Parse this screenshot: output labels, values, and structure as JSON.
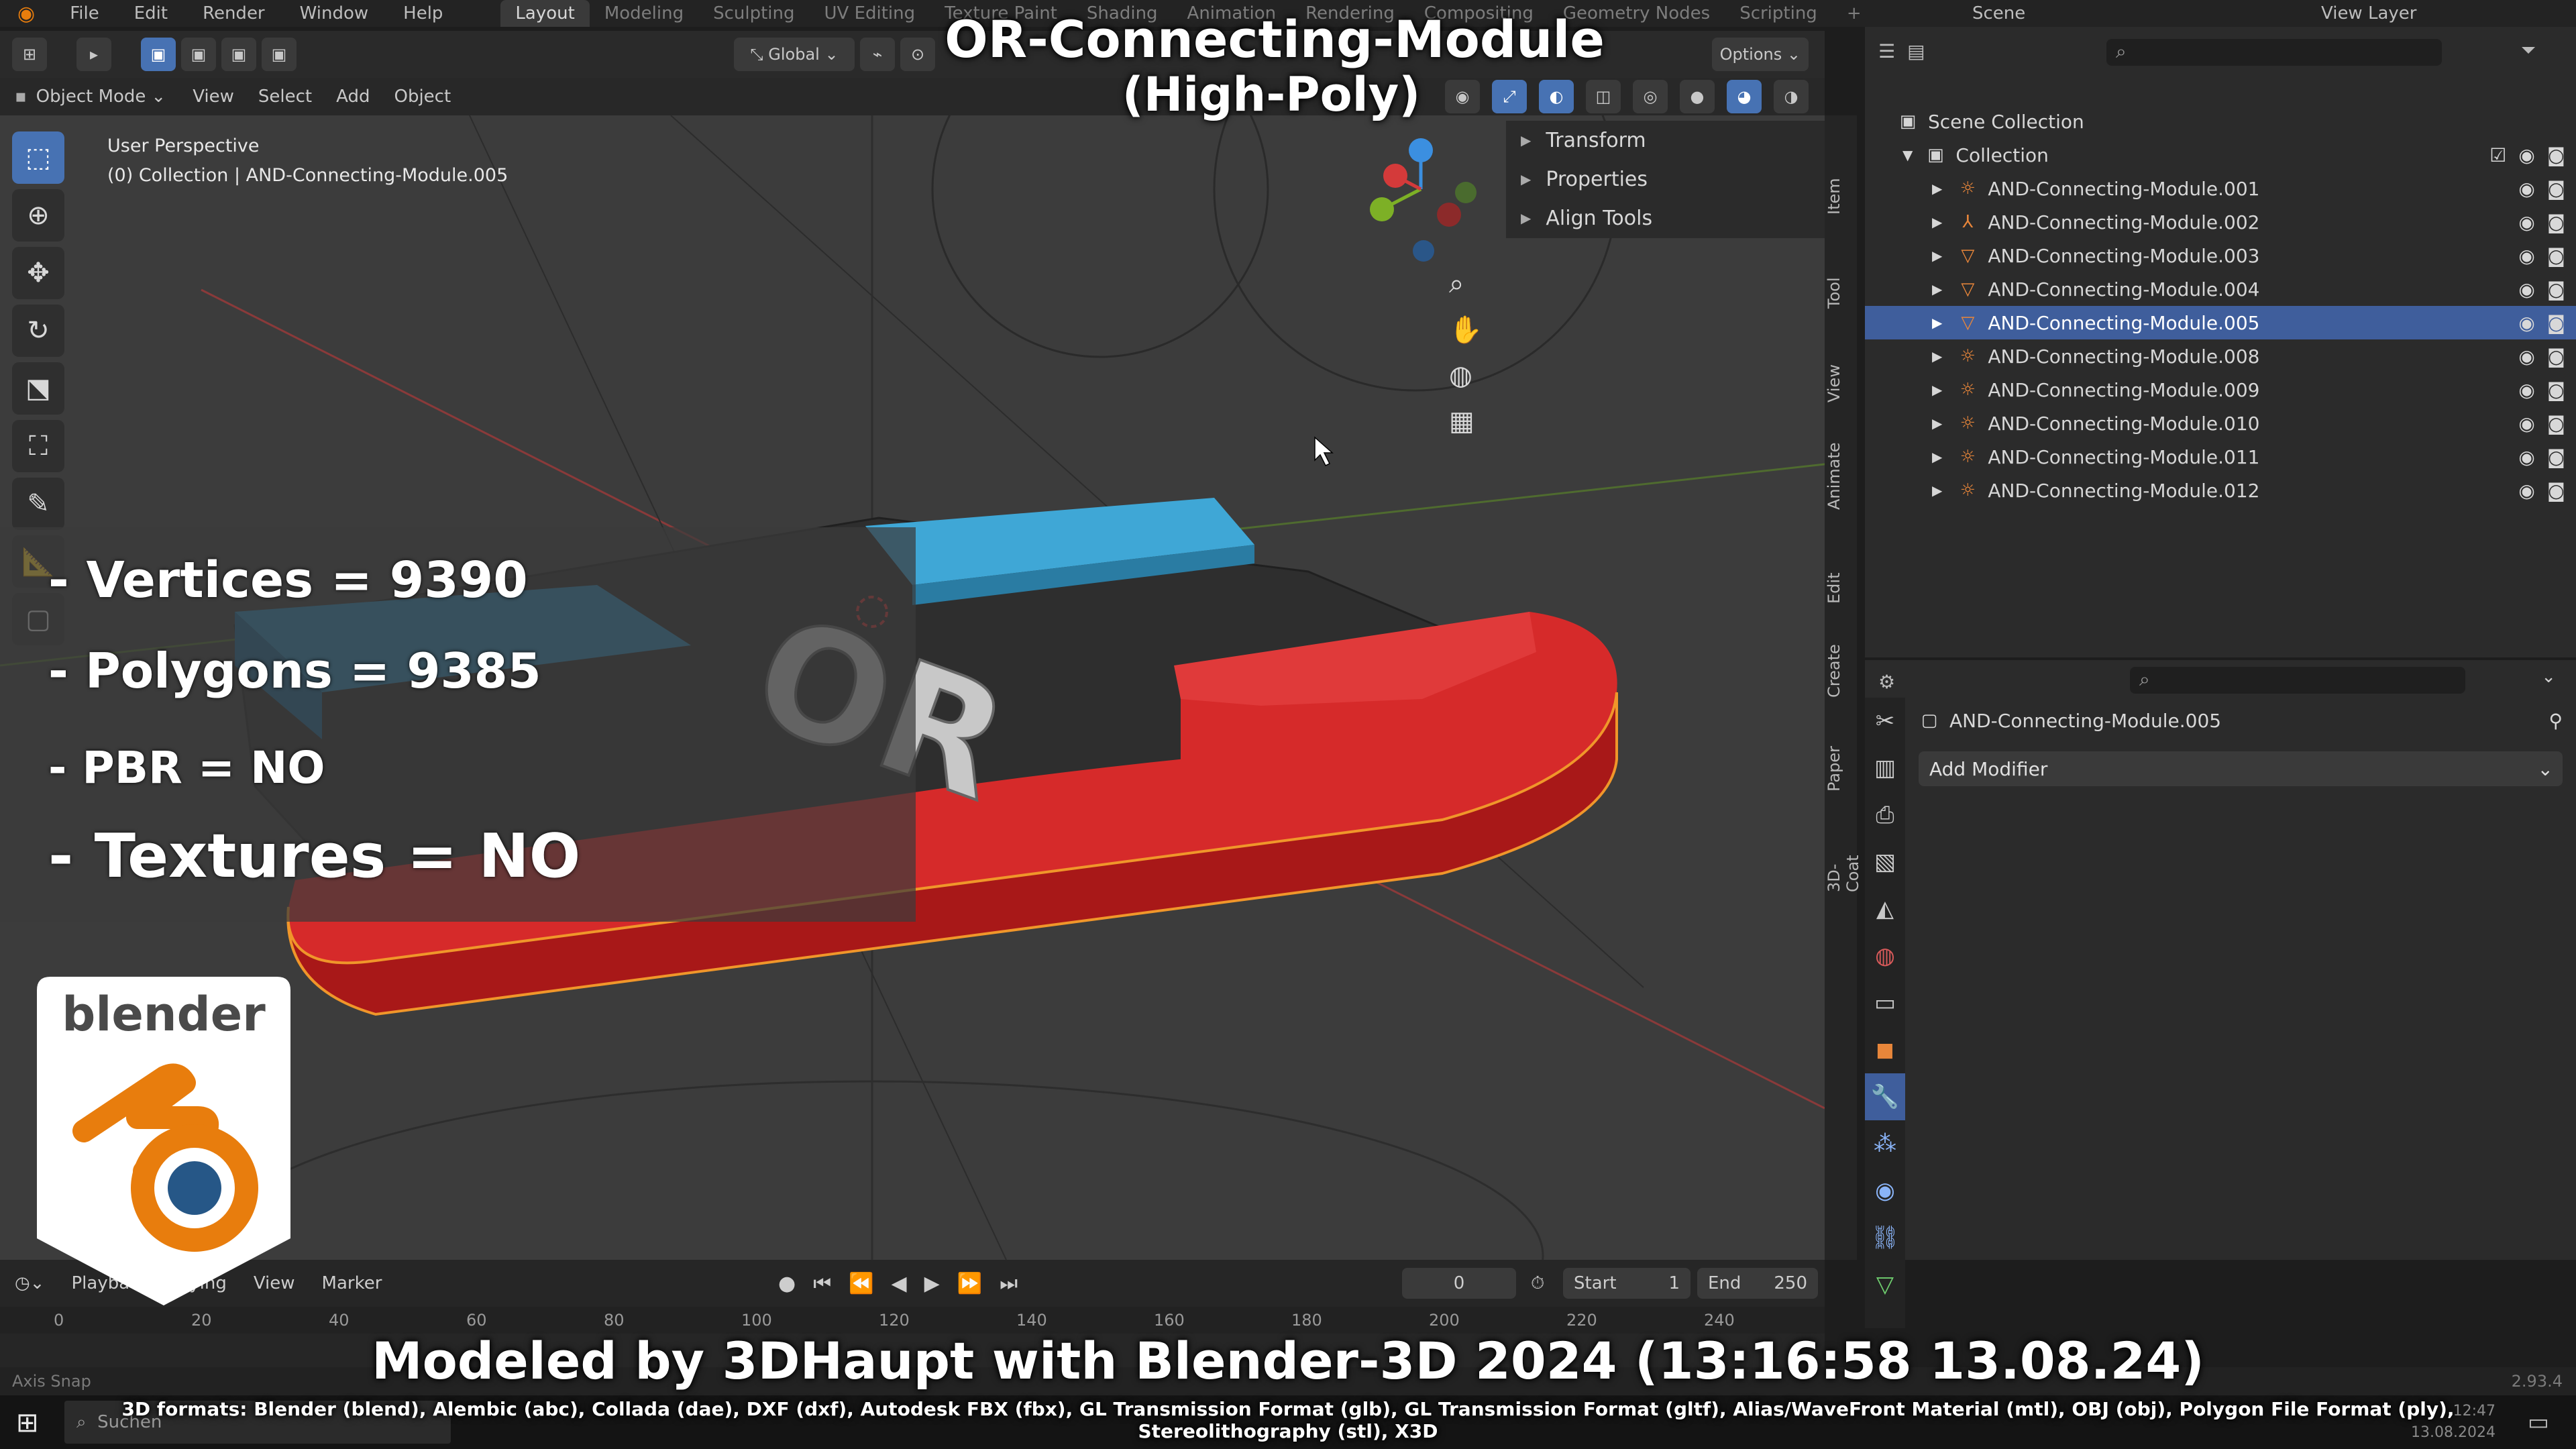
{
  "menus": [
    "File",
    "Edit",
    "Render",
    "Window",
    "Help"
  ],
  "workspaces": [
    "Layout",
    "Modeling",
    "Sculpting",
    "UV Editing",
    "Texture Paint",
    "Shading",
    "Animation",
    "Rendering",
    "Compositing",
    "Geometry Nodes",
    "Scripting"
  ],
  "topbar_right": {
    "scene": "Scene",
    "view_layer": "View Layer"
  },
  "header": {
    "transform_orientation": "Global",
    "options": "Options",
    "mode": "Object Mode",
    "menus": [
      "View",
      "Select",
      "Add",
      "Object"
    ]
  },
  "viewport": {
    "perspective": "User Perspective",
    "collection_info": "(0) Collection | AND-Connecting-Module.005",
    "n_panel": [
      "Transform",
      "Properties",
      "Align Tools"
    ],
    "side_tabs": [
      "Item",
      "Tool",
      "View",
      "Animate",
      "Edit",
      "Create",
      "Paper",
      "3D-Coat"
    ],
    "model_label": "OR"
  },
  "outliner": {
    "root": "Scene Collection",
    "collection": "Collection",
    "items": [
      {
        "name": "AND-Connecting-Module.001",
        "icon": "light-icon",
        "selected": false
      },
      {
        "name": "AND-Connecting-Module.002",
        "icon": "empty-icon",
        "selected": false
      },
      {
        "name": "AND-Connecting-Module.003",
        "icon": "mesh-icon",
        "selected": false
      },
      {
        "name": "AND-Connecting-Module.004",
        "icon": "mesh-icon",
        "selected": false
      },
      {
        "name": "AND-Connecting-Module.005",
        "icon": "mesh-icon",
        "selected": true
      },
      {
        "name": "AND-Connecting-Module.008",
        "icon": "light-icon",
        "selected": false
      },
      {
        "name": "AND-Connecting-Module.009",
        "icon": "light-icon",
        "selected": false
      },
      {
        "name": "AND-Connecting-Module.010",
        "icon": "light-icon",
        "selected": false
      },
      {
        "name": "AND-Connecting-Module.011",
        "icon": "light-icon",
        "selected": false
      },
      {
        "name": "AND-Connecting-Module.012",
        "icon": "light-icon",
        "selected": false
      }
    ]
  },
  "properties": {
    "object_name": "AND-Connecting-Module.005",
    "add_modifier": "Add Modifier"
  },
  "timeline": {
    "menus": [
      "Playback",
      "Keying",
      "View",
      "Marker"
    ],
    "current_frame": "0",
    "start_label": "Start",
    "start": "1",
    "end_label": "End",
    "end": "250",
    "ruler": [
      "0",
      "20",
      "40",
      "60",
      "80",
      "100",
      "120",
      "140",
      "160",
      "180",
      "200",
      "220",
      "240"
    ]
  },
  "statusbar": {
    "left": "Axis Snap",
    "version": "2.93.4"
  },
  "taskbar": {
    "search": "Suchen",
    "time": "12:47",
    "date": "13.08.2024"
  },
  "overlay": {
    "title_line1": "OR-Connecting-Module",
    "title_line2": "(High-Poly)",
    "vertices": "- Vertices = 9390",
    "polygons": "- Polygons = 9385",
    "pbr": "- PBR =  NO",
    "textures": "- Textures = NO",
    "credit": "Modeled by 3DHaupt with Blender-3D 2024 (13:16:58  13.08.24)",
    "formats": "3D formats: Blender (blend), Alembic (abc), Collada (dae), DXF (dxf), Autodesk FBX (fbx), GL Transmission Format (glb), GL Transmission Format (gltf), Alias/WaveFront Material (mtl), OBJ (obj), Polygon File Format (ply), Stereolithography (stl), X3D",
    "logo_text": "blender"
  },
  "colors": {
    "accent": "#4772b3",
    "selection": "#3f5e9c",
    "red": "#d62a2a",
    "blue": "#3fa7d6",
    "logo_orange": "#e87d0d",
    "logo_blue": "#265787"
  }
}
